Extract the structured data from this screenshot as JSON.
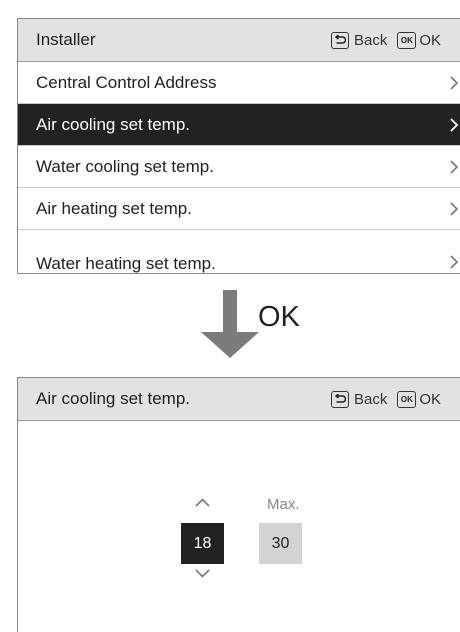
{
  "screen1": {
    "header": {
      "title": "Installer",
      "back_label": "Back",
      "ok_key": "OK",
      "ok_label": "OK"
    },
    "items": [
      {
        "label": "Central Control Address",
        "selected": false
      },
      {
        "label": "Air cooling set temp.",
        "selected": true
      },
      {
        "label": "Water cooling set temp.",
        "selected": false
      },
      {
        "label": "Air heating set temp.",
        "selected": false
      },
      {
        "label": "Water heating set temp.",
        "selected": false
      }
    ]
  },
  "transition": {
    "label": "OK",
    "icon": "down-arrow-icon"
  },
  "screen2": {
    "header": {
      "title": "Air cooling set temp.",
      "back_label": "Back",
      "ok_key": "OK",
      "ok_label": "OK"
    },
    "setting": {
      "value": "18",
      "max_label": "Max.",
      "max_value": "30"
    }
  },
  "colors": {
    "header_bg": "#e2e2e2",
    "selected_bg": "#222222",
    "max_box_bg": "#d3d3d3"
  }
}
